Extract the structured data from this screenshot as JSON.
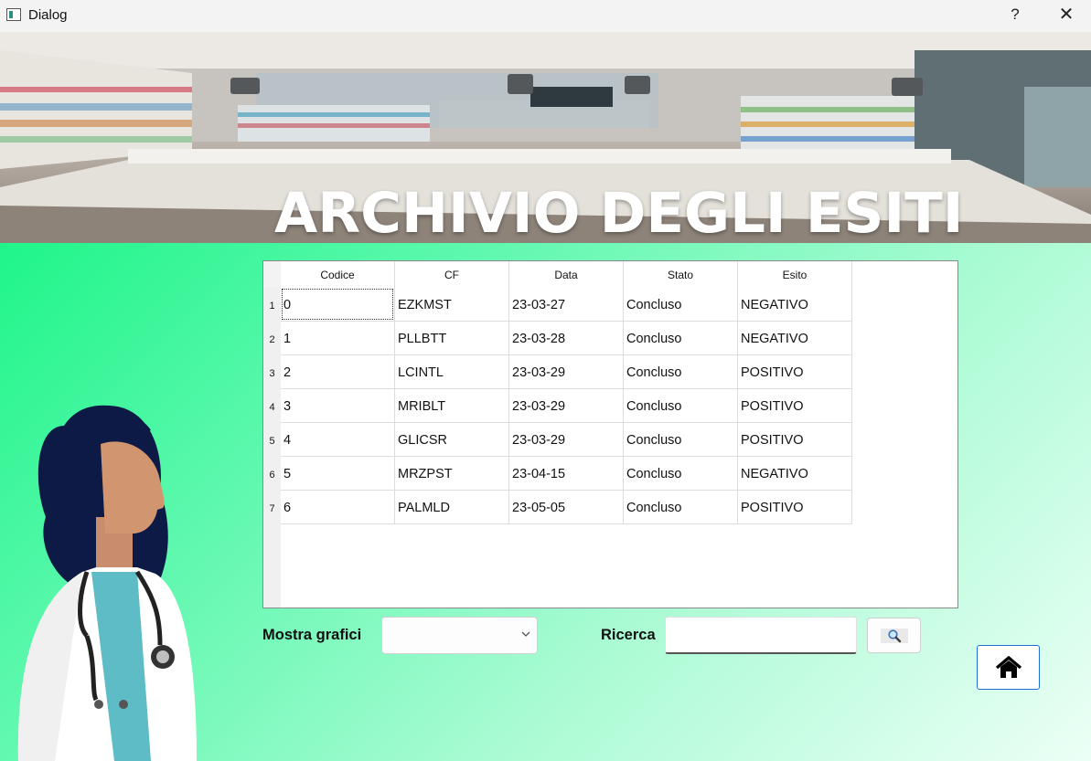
{
  "window": {
    "title": "Dialog",
    "help_label": "?",
    "close_label": "✕"
  },
  "banner": {
    "title": "ARCHIVIO DEGLI ESITI"
  },
  "table": {
    "columns": [
      "Codice",
      "CF",
      "Data",
      "Stato",
      "Esito"
    ],
    "row_numbers": [
      "1",
      "2",
      "3",
      "4",
      "5",
      "6",
      "7"
    ],
    "rows": [
      [
        "0",
        "EZKMST",
        "23-03-27",
        "Concluso",
        "NEGATIVO"
      ],
      [
        "1",
        "PLLBTT",
        "23-03-28",
        "Concluso",
        "NEGATIVO"
      ],
      [
        "2",
        "LCINTL",
        "23-03-29",
        "Concluso",
        "POSITIVO"
      ],
      [
        "3",
        "MRIBLT",
        "23-03-29",
        "Concluso",
        "POSITIVO"
      ],
      [
        "4",
        "GLICSR",
        "23-03-29",
        "Concluso",
        "POSITIVO"
      ],
      [
        "5",
        "MRZPST",
        "23-04-15",
        "Concluso",
        "NEGATIVO"
      ],
      [
        "6",
        "PALMLD",
        "23-05-05",
        "Concluso",
        "POSITIVO"
      ]
    ]
  },
  "controls": {
    "charts_label": "Mostra grafici",
    "charts_selected": "",
    "search_label": "Ricerca",
    "search_value": ""
  },
  "colors": {
    "background_gradient_start": "#1ff58a",
    "background_gradient_end": "#ecfff6",
    "home_button_border": "#1f6fd1"
  },
  "icons": {
    "search": "magnifier-icon",
    "home": "home-icon",
    "combo": "chevron-down-icon"
  }
}
